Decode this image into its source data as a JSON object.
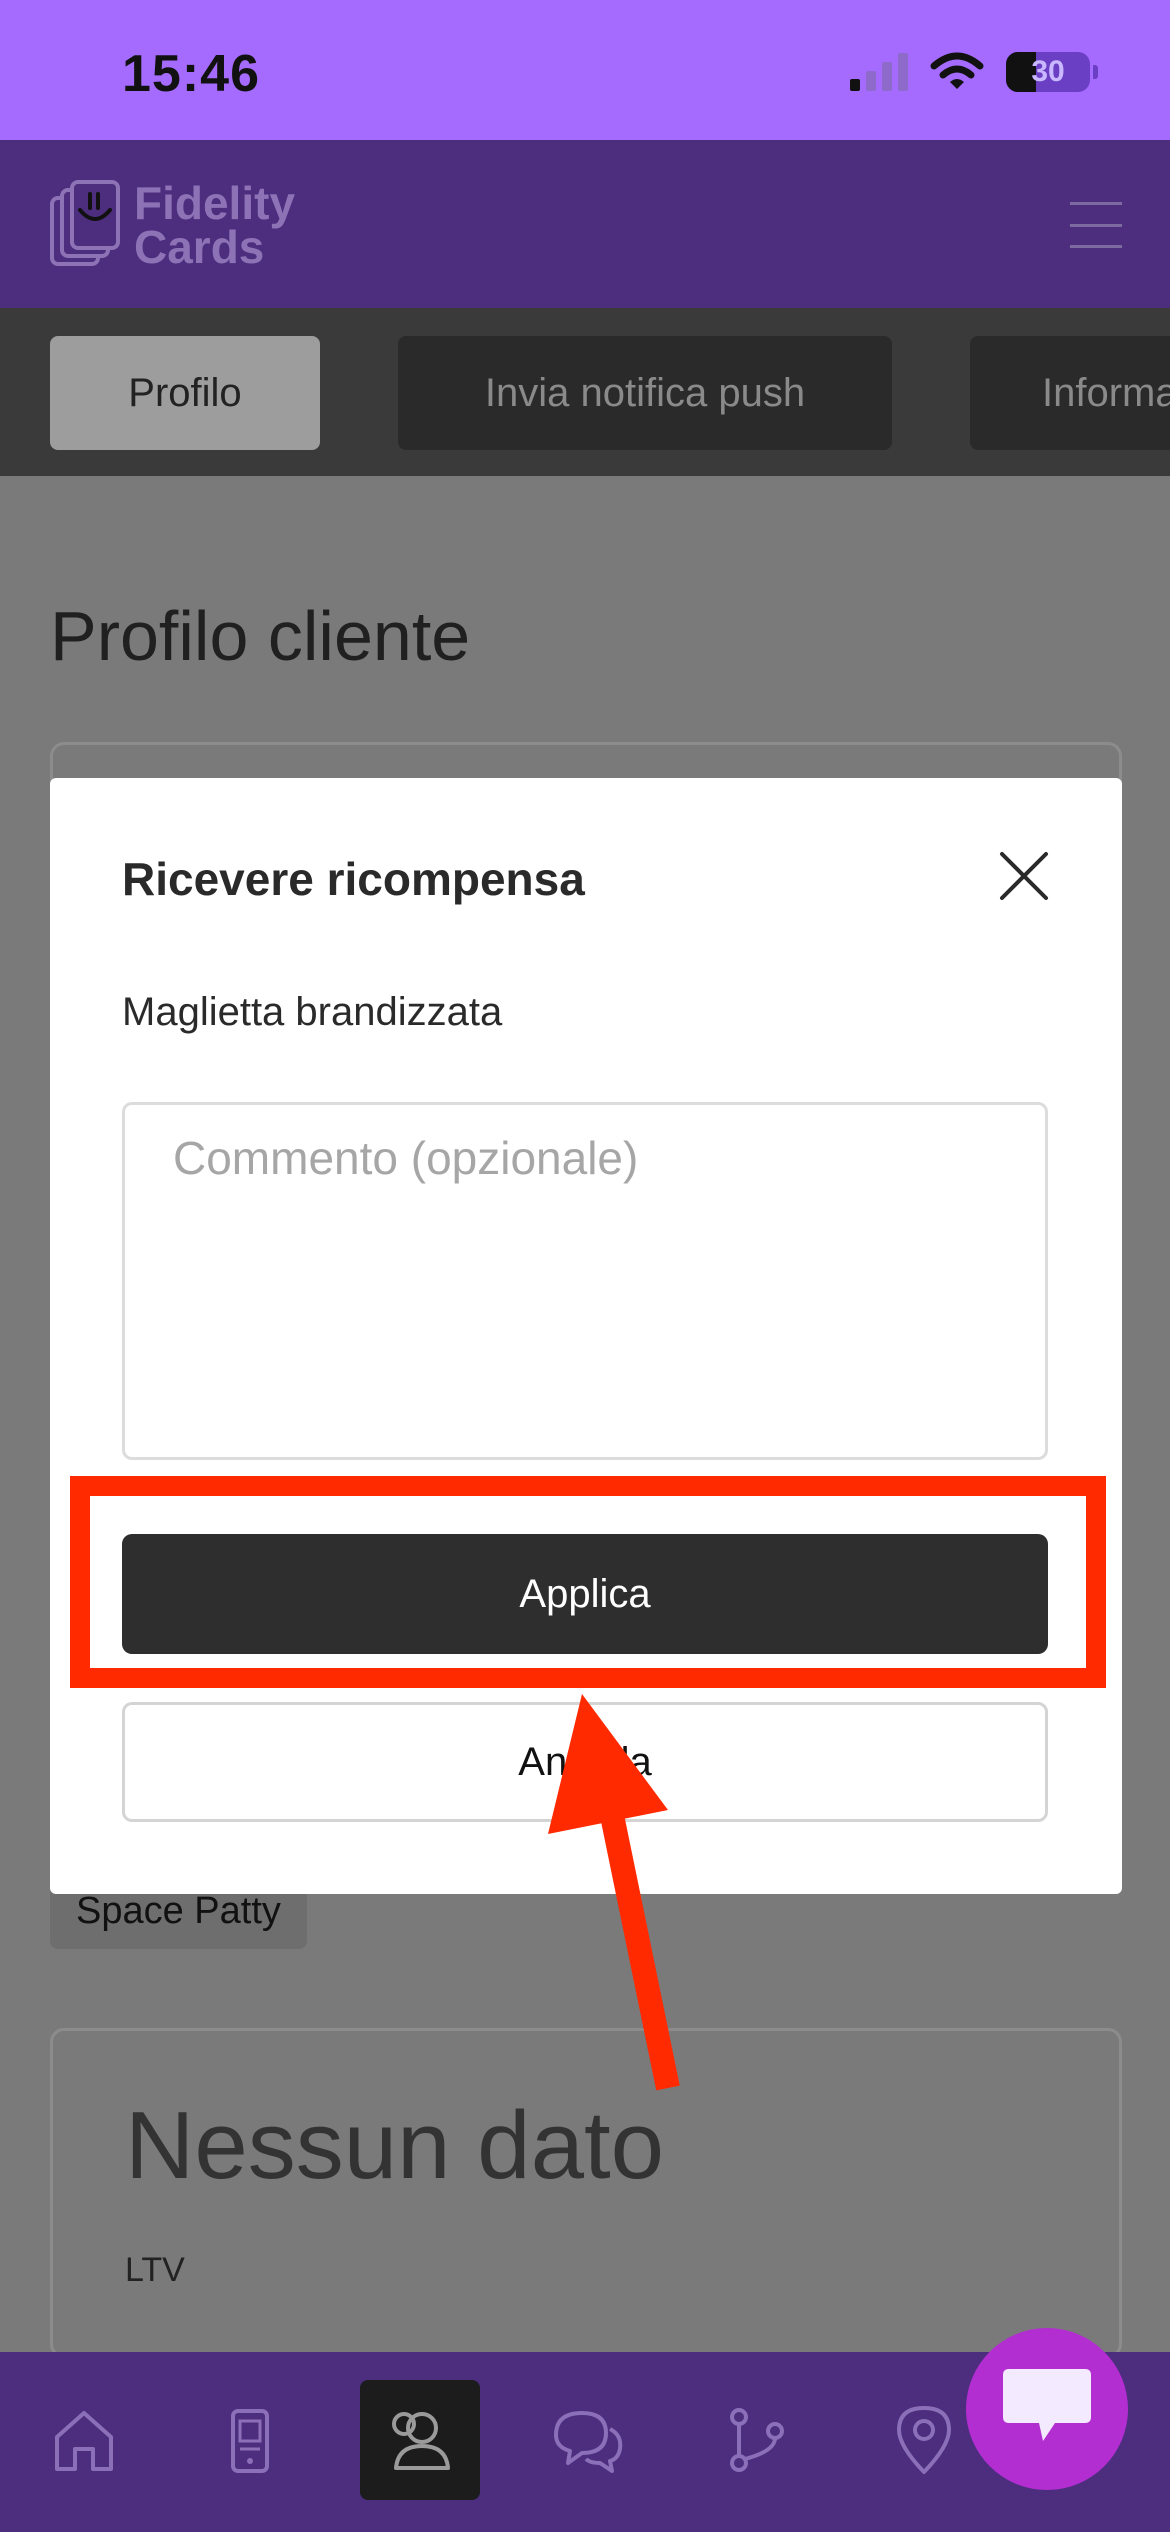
{
  "status_bar": {
    "time": "15:46",
    "battery": "30",
    "icons": [
      "cellular-signal-icon",
      "wifi-icon",
      "battery-icon"
    ]
  },
  "header": {
    "logo_line1": "Fidelity",
    "logo_line2": "Cards",
    "menu_icon": "hamburger-menu-icon"
  },
  "tabs": [
    {
      "label": "Profilo",
      "active": true
    },
    {
      "label": "Invia notifica push",
      "active": false
    },
    {
      "label": "Informa",
      "active": false
    }
  ],
  "page": {
    "title": "Profilo cliente",
    "tag": "Space Patty",
    "nodata": "Nessun dato",
    "ltv": "LTV"
  },
  "modal": {
    "title": "Ricevere ricompensa",
    "reward_name": "Maglietta brandizzata",
    "comment_placeholder": "Commento (opzionale)",
    "apply_label": "Applica",
    "cancel_label": "Annulla"
  },
  "bottom_nav": {
    "items": [
      "home-icon",
      "device-icon",
      "customer-icon",
      "chat-icon",
      "flow-icon",
      "location-icon"
    ],
    "active_index": 2
  },
  "colors": {
    "status_bar": "#a56bff",
    "brand_header": "#4c2d7e",
    "overlay_content": "#7a7a7a",
    "primary_button": "#2e2e2e",
    "annotation_red": "#ff2a00",
    "chat_fab": "#b32ed1"
  }
}
